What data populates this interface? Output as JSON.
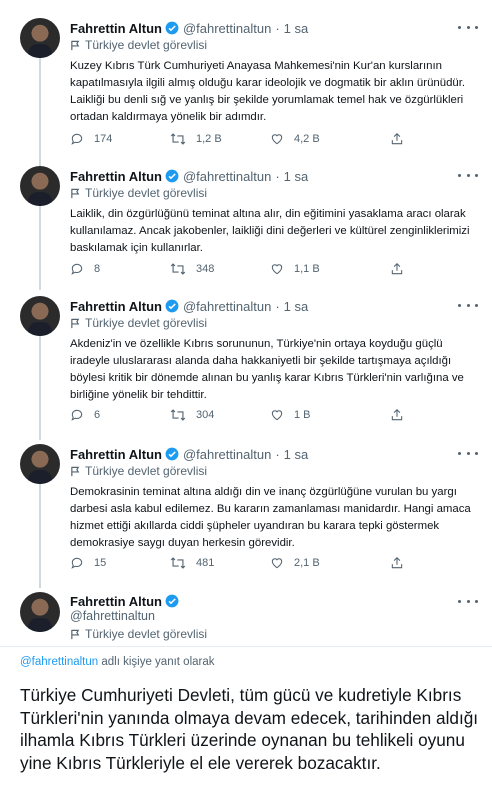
{
  "author": {
    "name": "Fahrettin Altun",
    "handle": "@fahrettinaltun",
    "label": "Türkiye devlet görevlisi"
  },
  "tweets": [
    {
      "time": "1 sa",
      "text": "Kuzey Kıbrıs Türk Cumhuriyeti Anayasa Mahkemesi'nin Kur'an kurslarının kapatılmasıyla ilgili almış olduğu karar ideolojik ve dogmatik bir aklın ürünüdür. Laikliği bu denli sığ ve yanlış bir şekilde yorumlamak temel hak ve özgürlükleri ortadan kaldırmaya yönelik bir adımdır.",
      "replies": "174",
      "retweets": "1,2 B",
      "likes": "4,2 B"
    },
    {
      "time": "1 sa",
      "text": "Laiklik, din özgürlüğünü teminat altına alır, din eğitimini yasaklama aracı olarak kullanılamaz. Ancak jakobenler, laikliği dini değerleri ve kültürel zenginliklerimizi baskılamak için kullanırlar.",
      "replies": "8",
      "retweets": "348",
      "likes": "1,1 B"
    },
    {
      "time": "1 sa",
      "text": "Akdeniz'in ve özellikle Kıbrıs sorununun, Türkiye'nin ortaya koyduğu güçlü iradeyle uluslararası alanda daha hakkaniyetli bir şekilde tartışmaya açıldığı böylesi kritik bir dönemde alınan bu yanlış karar Kıbrıs Türkleri'nin varlığına ve birliğine yönelik bir tehdittir.",
      "replies": "6",
      "retweets": "304",
      "likes": "1 B"
    },
    {
      "time": "1 sa",
      "text": "Demokrasinin teminat altına aldığı din ve inanç özgürlüğüne vurulan bu yargı darbesi asla kabul edilemez. Bu kararın zamanlaması manidardır. Hangi amaca hizmet ettiği akıllarda ciddi şüpheler uyandıran bu karara tepki göstermek demokrasiye saygı duyan herkesin görevidir.",
      "replies": "15",
      "retweets": "481",
      "likes": "2,1 B"
    }
  ],
  "main_tweet": {
    "reply_to_handle": "@fahrettinaltun",
    "reply_to_suffix": " adlı kişiye yanıt olarak",
    "text": "Türkiye Cumhuriyeti Devleti, tüm gücü ve kudretiyle Kıbrıs Türkleri'nin yanında olmaya devam edecek, tarihinden aldığı ilhamla Kıbrıs Türkleri üzerinde oynanan bu tehlikeli oyunu yine Kıbrıs Türkleriyle el ele vererek bozacaktır."
  },
  "colors": {
    "accent": "#1d9bf0",
    "secondary_text": "#536471",
    "primary_text": "#0f1419"
  }
}
